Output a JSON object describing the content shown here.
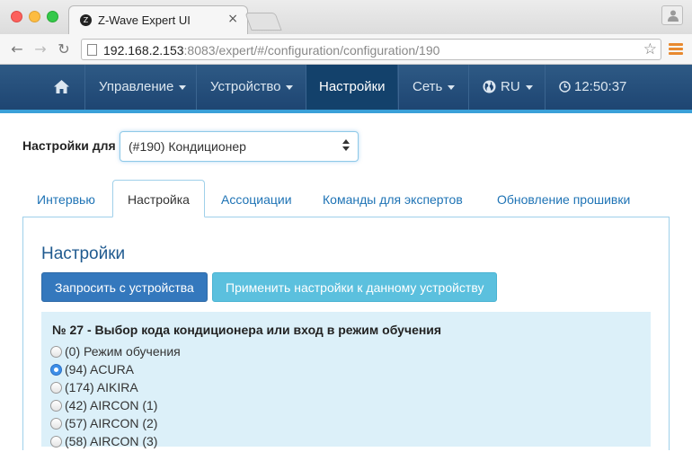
{
  "browser": {
    "tab_title": "Z-Wave Expert UI",
    "tab_close": "×",
    "url_host": "192.168.2.153",
    "url_rest": ":8083/expert/#/configuration/configuration/190"
  },
  "navbar": {
    "items": [
      {
        "label": "Управление"
      },
      {
        "label": "Устройство"
      },
      {
        "label": "Настройки"
      },
      {
        "label": "Сеть"
      },
      {
        "label": "RU"
      },
      {
        "label": "12:50:37"
      }
    ]
  },
  "settings_for": {
    "label": "Настройки для",
    "selected": "(#190) Кондиционер"
  },
  "tabs": [
    {
      "label": "Интервью"
    },
    {
      "label": "Настройка"
    },
    {
      "label": "Ассоциации"
    },
    {
      "label": "Команды для экспертов"
    },
    {
      "label": "Обновление прошивки"
    }
  ],
  "section": {
    "title": "Настройки",
    "btn_request": "Запросить с устройства",
    "btn_apply": "Применить настройки к данному устройству"
  },
  "parameter": {
    "title": "№ 27 - Выбор кода кондиционера или вход в режим обучения",
    "options": [
      {
        "label": "(0) Режим обучения"
      },
      {
        "label": "(94) ACURA"
      },
      {
        "label": "(174) AIKIRA"
      },
      {
        "label": "(42) AIRCON (1)"
      },
      {
        "label": "(57) AIRCON (2)"
      },
      {
        "label": "(58) AIRCON (3)"
      }
    ],
    "selected_index": 1
  },
  "colors": {
    "navbar": "#1e4572",
    "navbar_accent": "#3aa0d8",
    "primary_button": "#3478bd",
    "info_button": "#5bc0de",
    "param_background": "#dcf0f9",
    "link": "#1e73b5"
  }
}
